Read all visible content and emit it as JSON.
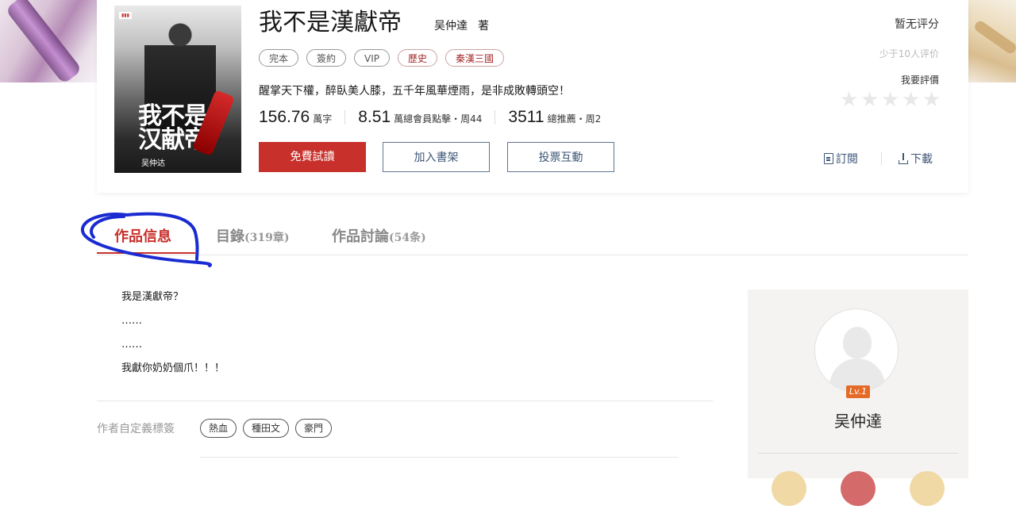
{
  "book": {
    "title": "我不是漢獻帝",
    "author": "吴仲達",
    "author_suffix": "著",
    "cover": {
      "title_text": "我不是汉献帝",
      "author_text": "吴仲达"
    },
    "tags": [
      "完本",
      "簽約",
      "VIP",
      "歷史",
      "秦漢三國"
    ],
    "intro": "醒掌天下權，醉臥美人膝，五千年風華煙雨，是非成敗轉頭空！",
    "stats": [
      {
        "value": "156.76",
        "unit": "萬字"
      },
      {
        "value": "8.51",
        "unit": "萬總會員點擊・周44"
      },
      {
        "value": "3511",
        "unit": "總推薦・周2"
      }
    ]
  },
  "buttons": {
    "read": "免費試讀",
    "shelf": "加入書架",
    "vote": "投票互動"
  },
  "rating": {
    "label": "暂无评分",
    "count": "少于10人评价",
    "rate_link": "我要評價",
    "stars": 5
  },
  "actions": {
    "subscribe": "訂閱",
    "download": "下載"
  },
  "tabs": {
    "info": "作品信息",
    "toc": "目錄",
    "toc_count": "(319章)",
    "discussion": "作品討論",
    "discussion_count": "(54条)"
  },
  "description": [
    "我是漢獻帝？",
    "……",
    "……",
    "我獻你奶奶個爪！！！"
  ],
  "custom_tags": {
    "label": "作者自定義標簽",
    "items": [
      "熱血",
      "種田文",
      "豪門"
    ]
  },
  "author_panel": {
    "level": "Lv.1",
    "name": "吴仲達"
  },
  "colors": {
    "accent": "#c8302b",
    "link": "#3d5677",
    "annotation": "#1a2bd1"
  }
}
